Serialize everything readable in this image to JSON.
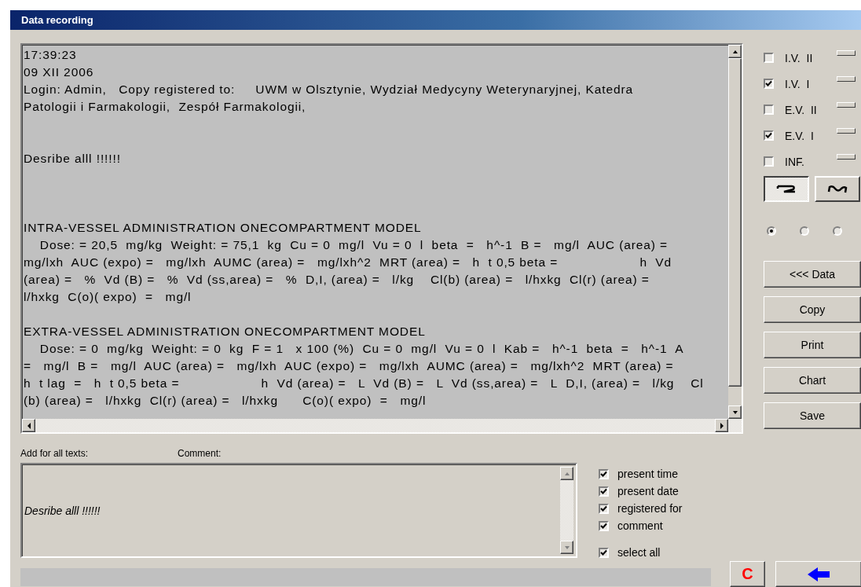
{
  "window": {
    "title": "Data recording"
  },
  "report": {
    "paragraphs": [
      {
        "lines": [
          "17:39:23",
          "09 XII 2006",
          "Login: Admin,   Copy registered to:     UWM w Olsztynie, Wydział Medycyny Weterynaryjnej, Katedra",
          "Patologii i Farmakologii,  Zespół Farmakologii,"
        ]
      },
      {
        "lines": [
          "Desribe alll !!!!!!"
        ]
      },
      {
        "lines": [
          "INTRA-VESSEL ADMINISTRATION ONECOMPARTMENT MODEL",
          "    Dose: = 20,5  mg/kg  Weight: = 75,1  kg  Cu = 0  mg/l  Vu = 0  l  beta  =   h^-1  B =   mg/l  AUC (area) =",
          "mg/lxh  AUC (expo) =   mg/lxh  AUMC (area) =   mg/lxh^2  MRT (area) =   h  t 0,5 beta =                    h  Vd",
          "(area) =   %  Vd (B) =   %  Vd (ss,area) =   %  D,I, (area) =   l/kg    Cl(b) (area) =   l/hxkg  Cl(r) (area) =",
          "l/hxkg  C(o)( expo)  =   mg/l"
        ]
      },
      {
        "lines": [
          "EXTRA-VESSEL ADMINISTRATION ONECOMPARTMENT MODEL",
          "    Dose: = 0  mg/kg  Weight: = 0  kg  F = 1   x 100 (%)  Cu = 0  mg/l  Vu = 0  l  Kab =   h^-1  beta  =   h^-1  A",
          "=   mg/l  B =   mg/l  AUC (area) =   mg/lxh  AUC (expo) =   mg/lxh  AUMC (area) =   mg/lxh^2  MRT (area) =",
          "h  t lag  =   h  t 0,5 beta =                    h  Vd (area) =   L  Vd (B) =   L  Vd (ss,area) =   L  D,I, (area) =   l/kg    Cl",
          "(b) (area) =   l/hxkg  Cl(r) (area) =   l/hxkg      C(o)( expo)  =   mg/l"
        ]
      }
    ]
  },
  "models": [
    {
      "label": "I.V.  II",
      "checked": false
    },
    {
      "label": "I.V.  I",
      "checked": true
    },
    {
      "label": "E.V.  II",
      "checked": false
    },
    {
      "label": "E.V.  I",
      "checked": true
    },
    {
      "label": "INF.",
      "checked": false
    }
  ],
  "curve_buttons": [
    {
      "kind": "zigzag",
      "selected": true
    },
    {
      "kind": "wave",
      "selected": false
    }
  ],
  "radios": [
    {
      "selected": true
    },
    {
      "selected": false
    },
    {
      "selected": false
    }
  ],
  "buttons": [
    "<<<  Data",
    "Copy",
    "Print",
    "Chart",
    "Save"
  ],
  "add_label": "Add for all texts:",
  "comment_label": "Comment:",
  "comment": {
    "value": "Desribe alll !!!!!!"
  },
  "include_options": [
    {
      "label": "present time",
      "checked": true
    },
    {
      "label": "present date",
      "checked": true
    },
    {
      "label": "registered for",
      "checked": true
    },
    {
      "label": "comment",
      "checked": true
    }
  ],
  "select_all": {
    "label": "select all",
    "checked": true
  },
  "clear_button": {
    "label": "C"
  }
}
